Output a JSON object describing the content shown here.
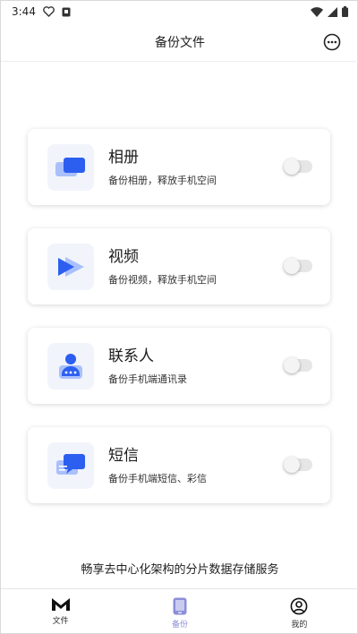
{
  "status_bar": {
    "time": "3:44"
  },
  "header": {
    "title": "备份文件"
  },
  "cards": [
    {
      "title": "相册",
      "desc": "备份相册，释放手机空间",
      "icon": "photo-album-icon",
      "enabled": false
    },
    {
      "title": "视频",
      "desc": "备份视频，释放手机空间",
      "icon": "video-play-icon",
      "enabled": false
    },
    {
      "title": "联系人",
      "desc": "备份手机端通讯录",
      "icon": "contact-icon",
      "enabled": false
    },
    {
      "title": "短信",
      "desc": "备份手机端短信、彩信",
      "icon": "message-icon",
      "enabled": false
    }
  ],
  "slogan": "畅享去中心化架构的分片数据存储服务",
  "nav": [
    {
      "label": "文件",
      "icon": "m-logo-icon",
      "active": false
    },
    {
      "label": "备份",
      "icon": "phone-icon",
      "active": true
    },
    {
      "label": "我的",
      "icon": "user-icon",
      "active": false
    }
  ],
  "colors": {
    "accent": "#2c5ff0",
    "accent_light": "#a9c0fb",
    "nav_active": "#8a8fd8",
    "toggle_off": "#e6e6e6"
  }
}
